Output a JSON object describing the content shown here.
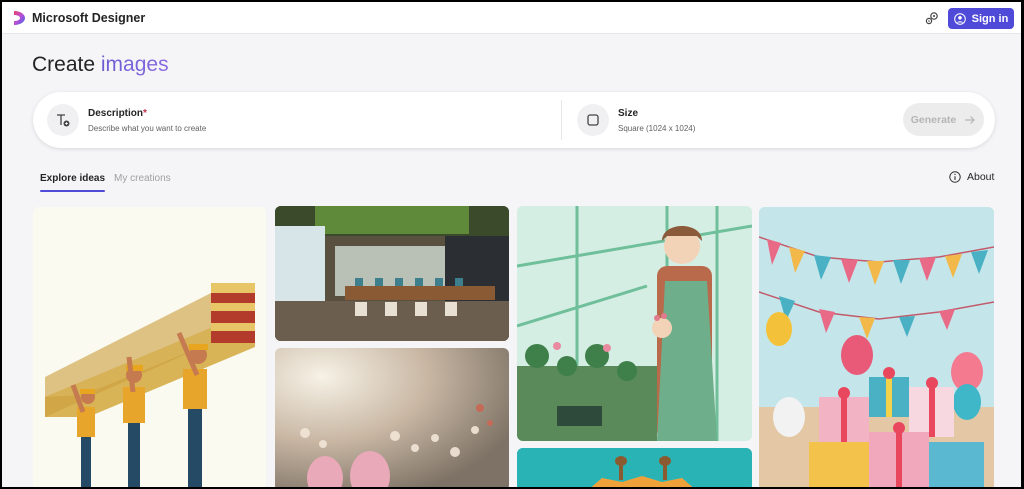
{
  "topbar": {
    "brand": "Microsoft Designer",
    "signin_label": "Sign in"
  },
  "heading": {
    "prefix": "Create",
    "accent": "images"
  },
  "prompt": {
    "description_title": "Description",
    "description_required": "*",
    "description_hint": "Describe what you want to create",
    "size_title": "Size",
    "size_value": "Square (1024 x 1024)",
    "generate_label": "Generate"
  },
  "tabs": [
    {
      "label": "Explore ideas",
      "active": true
    },
    {
      "label": "My creations",
      "active": false
    }
  ],
  "about_label": "About",
  "icons": {
    "logo": "designer-logo-icon",
    "settings": "settings-icon",
    "user": "user-icon",
    "description": "text-edit-icon",
    "size": "square-icon",
    "arrow": "arrow-right-icon",
    "info": "info-icon"
  },
  "colors": {
    "accent": "#4f4ad8",
    "heading_accent": "#7b63da",
    "background": "#f5f5f7"
  }
}
